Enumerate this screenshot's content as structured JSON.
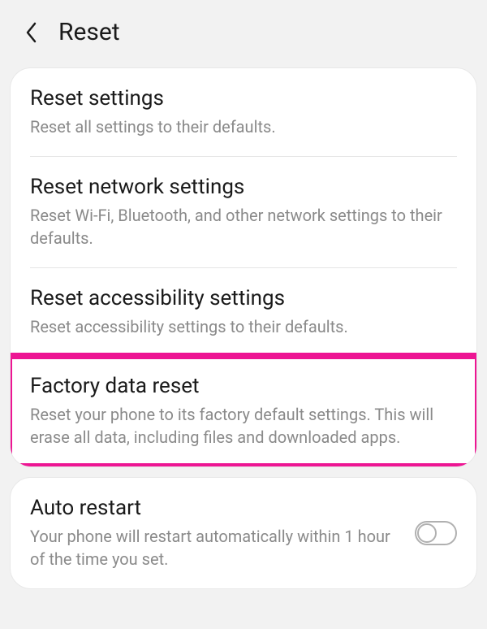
{
  "header": {
    "title": "Reset"
  },
  "reset_section": {
    "items": [
      {
        "title": "Reset settings",
        "desc": "Reset all settings to their defaults."
      },
      {
        "title": "Reset network settings",
        "desc": "Reset Wi-Fi, Bluetooth, and other network settings to their defaults."
      },
      {
        "title": "Reset accessibility settings",
        "desc": "Reset accessibility settings to their defaults."
      },
      {
        "title": "Factory data reset",
        "desc": "Reset your phone to its factory default settings. This will erase all data, including files and downloaded apps."
      }
    ]
  },
  "auto_restart": {
    "title": "Auto restart",
    "desc": "Your phone will restart automatically within 1 hour of the time you set."
  }
}
